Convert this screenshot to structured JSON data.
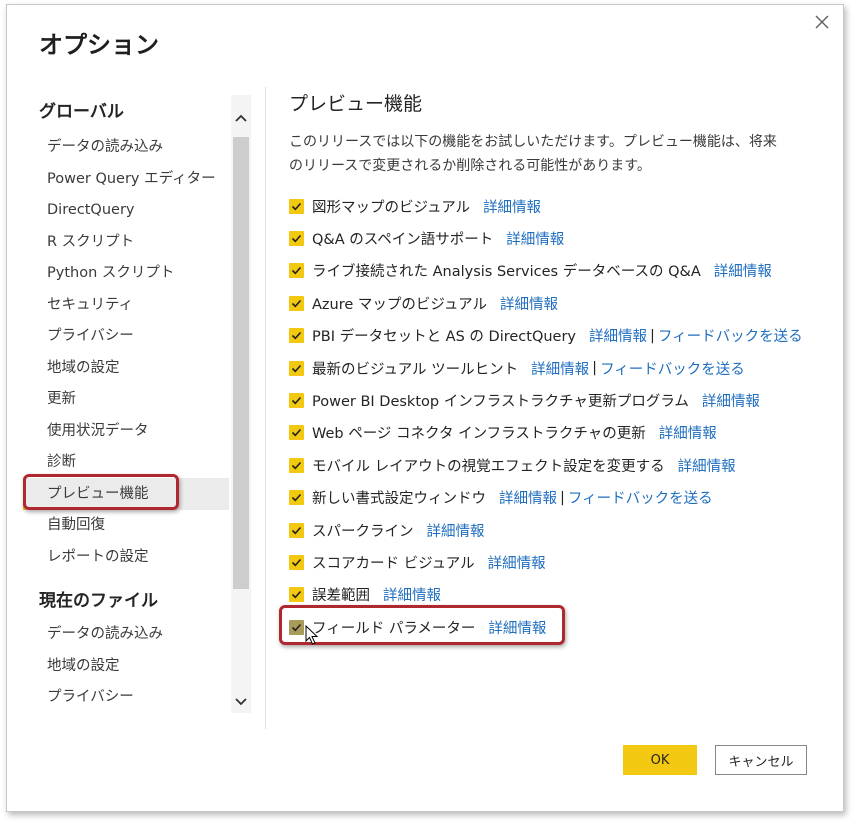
{
  "dialog": {
    "title": "オプション",
    "ok_label": "OK",
    "cancel_label": "キャンセル"
  },
  "nav": {
    "global_heading": "グローバル",
    "global_items": [
      {
        "label": "データの読み込み"
      },
      {
        "label": "Power Query エディター"
      },
      {
        "label": "DirectQuery"
      },
      {
        "label": "R スクリプト"
      },
      {
        "label": "Python スクリプト"
      },
      {
        "label": "セキュリティ"
      },
      {
        "label": "プライバシー"
      },
      {
        "label": "地域の設定"
      },
      {
        "label": "更新"
      },
      {
        "label": "使用状況データ"
      },
      {
        "label": "診断"
      },
      {
        "label": "プレビュー機能"
      },
      {
        "label": "自動回復"
      },
      {
        "label": "レポートの設定"
      }
    ],
    "selected": "プレビュー機能",
    "file_heading": "現在のファイル",
    "file_items": [
      {
        "label": "データの読み込み"
      },
      {
        "label": "地域の設定"
      },
      {
        "label": "プライバシー"
      }
    ]
  },
  "content": {
    "title": "プレビュー機能",
    "description": "このリリースでは以下の機能をお試しいただけます。プレビュー機能は、将来のリリースで変更されるか削除される可能性があります。",
    "details_link": "詳細情報",
    "feedback_link": "フィードバックを送る",
    "separator": "|",
    "features": [
      {
        "label": "図形マップのビジュアル",
        "checked": true,
        "feedback": false
      },
      {
        "label": "Q&A のスペイン語サポート",
        "checked": true,
        "feedback": false
      },
      {
        "label": "ライブ接続された Analysis Services データベースの Q&A",
        "checked": true,
        "feedback": false
      },
      {
        "label": "Azure マップのビジュアル",
        "checked": true,
        "feedback": false
      },
      {
        "label": "PBI データセットと AS の DirectQuery",
        "checked": true,
        "feedback": true
      },
      {
        "label": "最新のビジュアル ツールヒント",
        "checked": true,
        "feedback": true
      },
      {
        "label": "Power BI Desktop インフラストラクチャ更新プログラム",
        "checked": true,
        "feedback": false
      },
      {
        "label": "Web ページ コネクタ インフラストラクチャの更新",
        "checked": true,
        "feedback": false
      },
      {
        "label": "モバイル レイアウトの視覚エフェクト設定を変更する",
        "checked": true,
        "feedback": false
      },
      {
        "label": "新しい書式設定ウィンドウ",
        "checked": true,
        "feedback": true
      },
      {
        "label": "スパークライン",
        "checked": true,
        "feedback": false
      },
      {
        "label": "スコアカード ビジュアル",
        "checked": true,
        "feedback": false
      },
      {
        "label": "誤差範囲",
        "checked": true,
        "feedback": false
      },
      {
        "label": "フィールド パラメーター",
        "checked": true,
        "feedback": false
      }
    ]
  },
  "colors": {
    "accent": "#f2c811",
    "link": "#1f6ebf",
    "highlight": "#b0282f"
  }
}
